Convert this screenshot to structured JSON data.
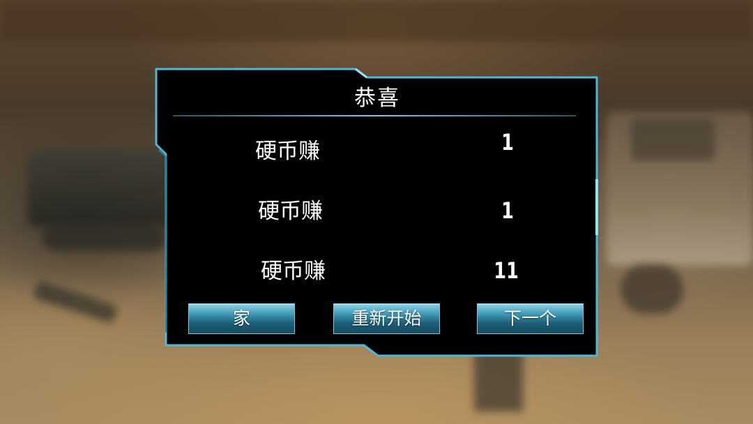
{
  "dialog": {
    "title": "恭喜",
    "rows": [
      {
        "label": "硬币赚",
        "value": "1"
      },
      {
        "label": "硬币赚",
        "value": "1"
      },
      {
        "label": "硬币赚",
        "value": "11"
      }
    ],
    "buttons": {
      "home": "家",
      "restart": "重新开始",
      "next": "下一个"
    }
  },
  "colors": {
    "frame_border": "#4fb8d8",
    "dialog_background": "#000000",
    "button_top": "#8ad3e6",
    "button_bottom": "#164b60",
    "text": "#ffffff"
  }
}
